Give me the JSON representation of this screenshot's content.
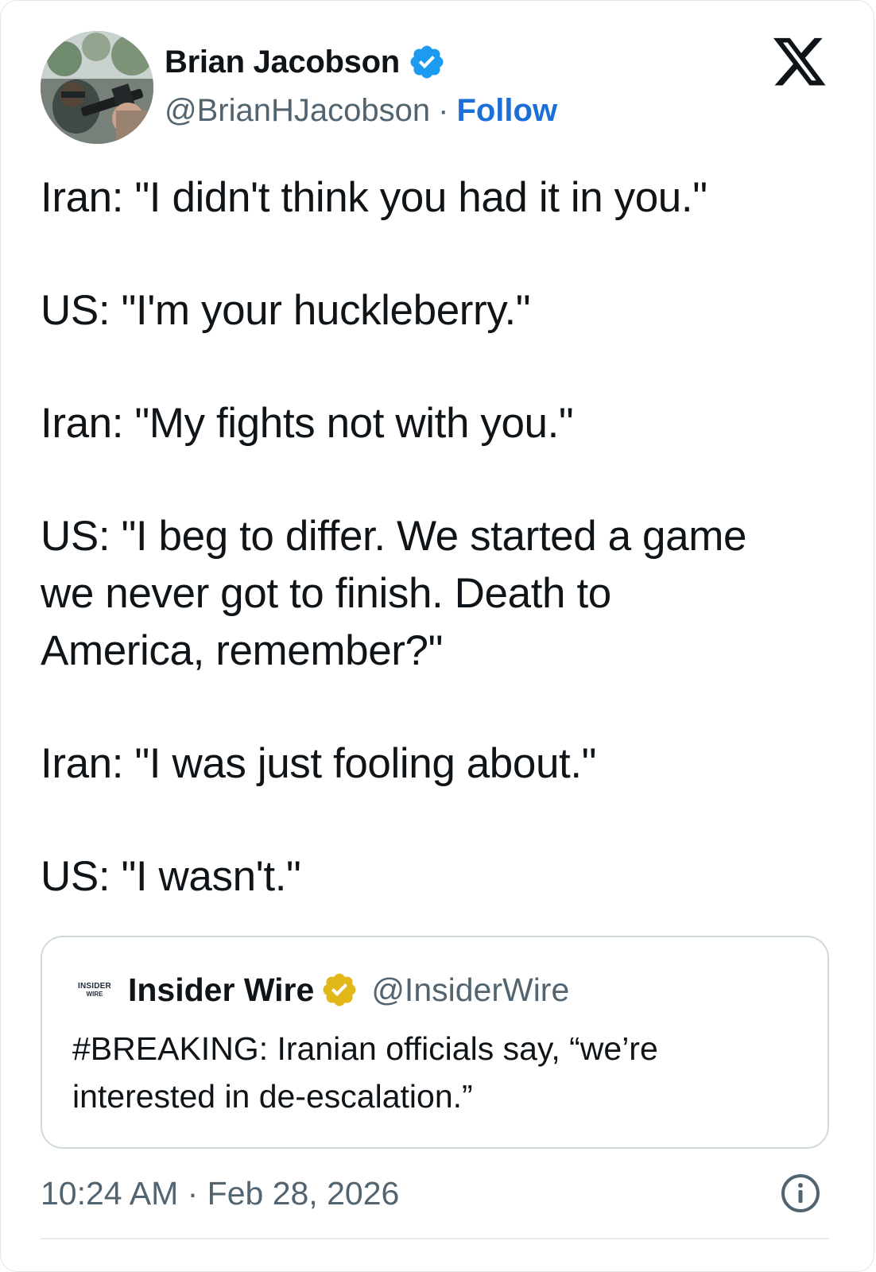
{
  "author": {
    "display_name": "Brian Jacobson",
    "handle": "@BrianHJacobson",
    "separator": "·",
    "follow_label": "Follow",
    "verified": true,
    "avatar_icon": "avatar-photo"
  },
  "platform": {
    "logo": "x-logo"
  },
  "tweet": {
    "lines": [
      "Iran: \"I didn't think you had it in you.\"",
      "US: \"I'm your huckleberry.\"",
      "Iran: \"My fights not with you.\"",
      "US: \"I beg to differ. We started a game\nwe never got to finish. Death to\nAmerica, remember?\"",
      "Iran: \"I was just fooling about.\"",
      "US: \"I wasn't.\""
    ]
  },
  "quote": {
    "logo_line1": "INSIDER",
    "logo_line2": "WIRE",
    "name": "Insider Wire",
    "handle": "@InsiderWire",
    "badge": "gold-verified",
    "text": "#BREAKING: Iranian officials say, “we’re\ninterested in de-escalation.”"
  },
  "footer": {
    "timestamp": "10:24 AM · Feb 28, 2026",
    "info_icon": "info-icon"
  },
  "colors": {
    "link": "#1d6fd8",
    "verified_blue": "#1d9bf0",
    "verified_gold": "#e2b719",
    "secondary_text": "#536471",
    "primary_text": "#0f1419",
    "border": "#cfd9de"
  }
}
